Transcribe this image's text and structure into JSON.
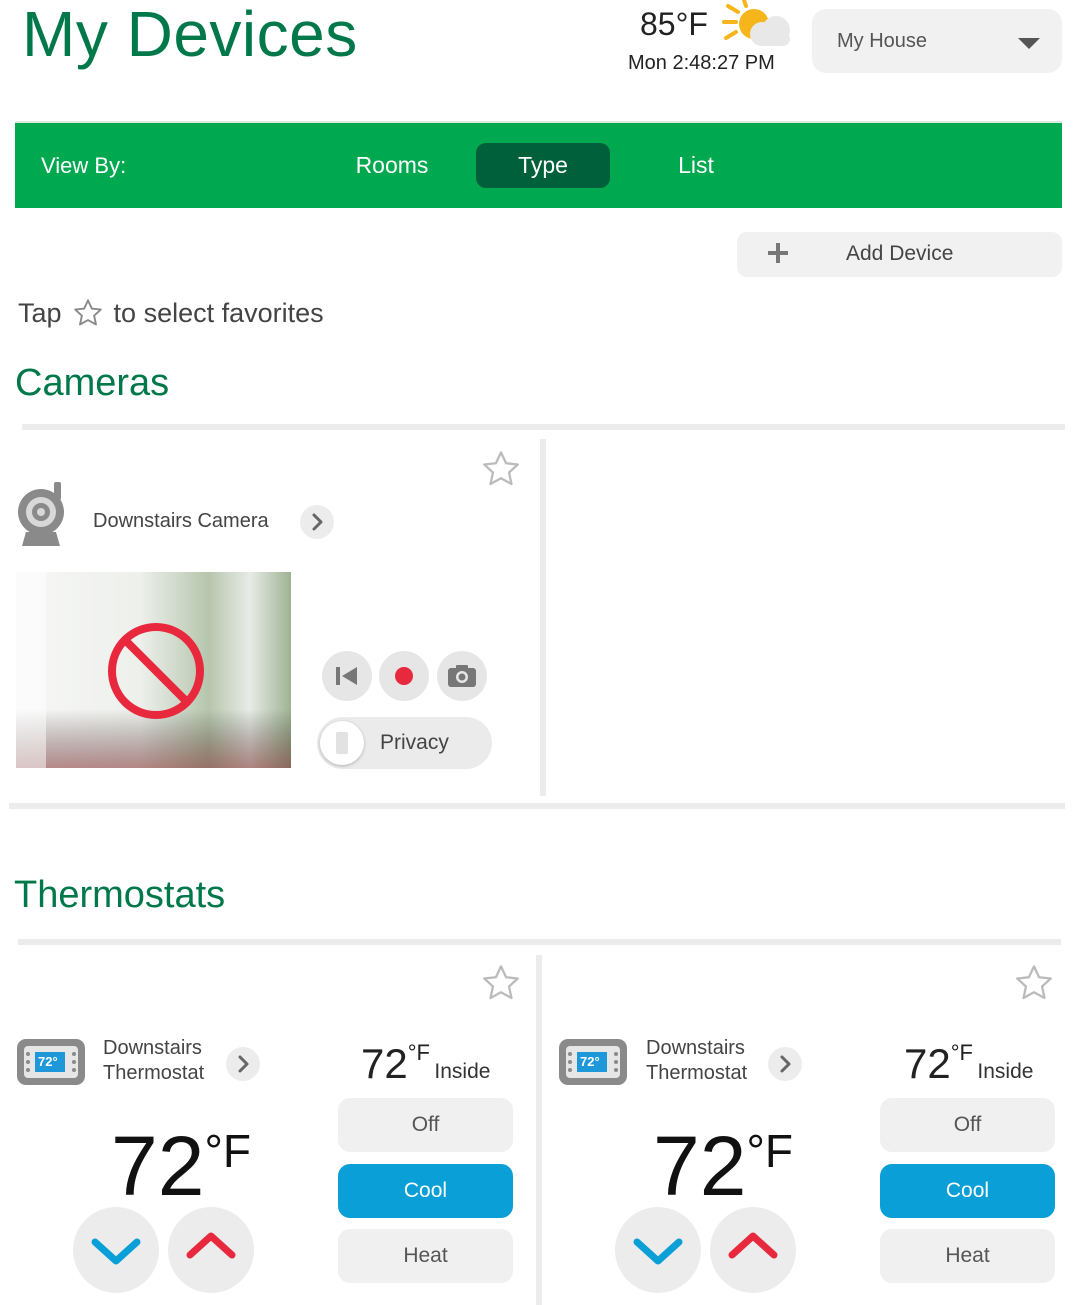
{
  "header": {
    "title": "My Devices",
    "weather": {
      "temperature": "85°F",
      "time": "Mon 2:48:27 PM",
      "icon": "partly-sunny-icon"
    },
    "location_select": {
      "value": "My House"
    }
  },
  "viewbar": {
    "label": "View By:",
    "tabs": [
      {
        "label": "Rooms",
        "active": false
      },
      {
        "label": "Type",
        "active": true
      },
      {
        "label": "List",
        "active": false
      }
    ]
  },
  "add_device": {
    "label": "Add Device"
  },
  "favorites_hint": {
    "before": "Tap",
    "after": "to select favorites"
  },
  "cameras": {
    "section_title": "Cameras",
    "items": [
      {
        "name": "Downstairs Camera",
        "privacy_label": "Privacy",
        "privacy_on": false,
        "feed_status": "blocked"
      }
    ]
  },
  "thermostats": {
    "section_title": "Thermostats",
    "items": [
      {
        "name_line1": "Downstairs",
        "name_line2": "Thermostat",
        "badge": "72°",
        "setpoint": "72",
        "setpoint_unit": "°F",
        "inside_temp": "72",
        "inside_unit": "°F",
        "inside_label": "Inside",
        "modes": [
          {
            "label": "Off",
            "active": false
          },
          {
            "label": "Cool",
            "active": true
          },
          {
            "label": "Heat",
            "active": false
          }
        ]
      },
      {
        "name_line1": "Downstairs",
        "name_line2": "Thermostat",
        "badge": "72°",
        "setpoint": "72",
        "setpoint_unit": "°F",
        "inside_temp": "72",
        "inside_unit": "°F",
        "inside_label": "Inside",
        "modes": [
          {
            "label": "Off",
            "active": false
          },
          {
            "label": "Cool",
            "active": true
          },
          {
            "label": "Heat",
            "active": false
          }
        ]
      }
    ]
  },
  "colors": {
    "brand_green": "#00a84f",
    "dark_green": "#00603b",
    "title_green": "#00784a",
    "cool_blue": "#0a9fd6",
    "alert_red": "#e8283c"
  }
}
